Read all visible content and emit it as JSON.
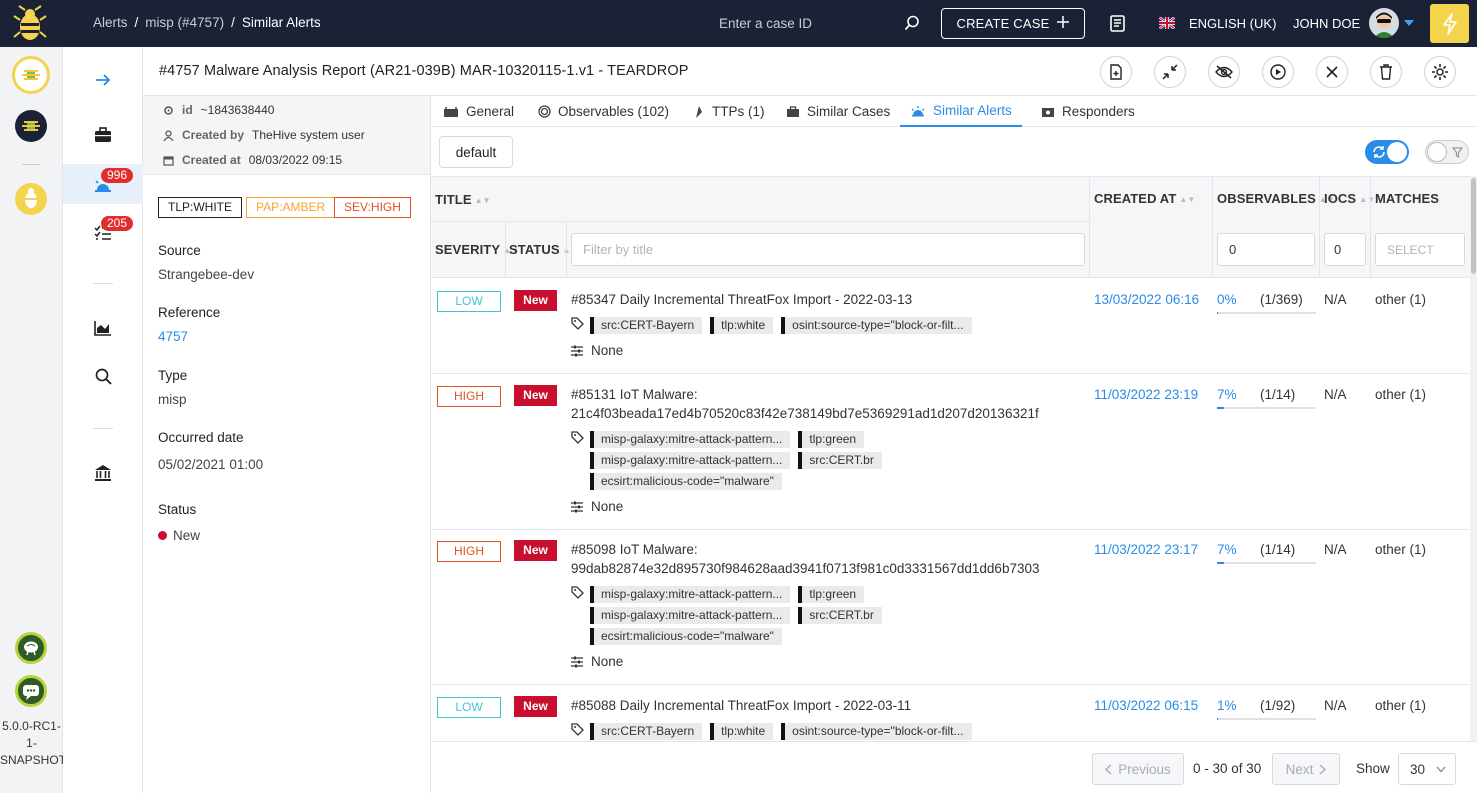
{
  "topbar": {
    "breadcrumb": [
      "Alerts",
      "misp (#4757)",
      "Similar Alerts"
    ],
    "case_search_placeholder": "Enter a case ID",
    "create_case_label": "CREATE CASE",
    "language": "ENGLISH (UK)",
    "user_name": "JOHN DOE"
  },
  "rail": {
    "version": "5.0.0-RC1-\n1-\nSNAPSHOT"
  },
  "nav": {
    "alerts_badge": "996",
    "tasks_badge": "205"
  },
  "header": {
    "title": "#4757 Malware Analysis Report (AR21-039B) MAR-10320115-1.v1 - TEARDROP"
  },
  "details": {
    "id_label": "id",
    "id_value": "~1843638440",
    "created_by_label": "Created by",
    "created_by_value": "TheHive system user",
    "created_at_label": "Created at",
    "created_at_value": "08/03/2022 09:15",
    "tlp": "TLP:WHITE",
    "pap": "PAP:AMBER",
    "sev": "SEV:HIGH",
    "source_label": "Source",
    "source_value": "Strangebee-dev",
    "reference_label": "Reference",
    "reference_value": "4757",
    "type_label": "Type",
    "type_value": "misp",
    "occurred_label": "Occurred date",
    "occurred_value": "05/02/2021 01:00",
    "status_label": "Status",
    "status_value": "New"
  },
  "tabs": [
    {
      "label": "General"
    },
    {
      "label": "Observables (102)"
    },
    {
      "label": "TTPs (1)"
    },
    {
      "label": "Similar Cases"
    },
    {
      "label": "Similar Alerts"
    },
    {
      "label": "Responders"
    }
  ],
  "toolbar": {
    "default_label": "default"
  },
  "table": {
    "headers": {
      "title": "TITLE",
      "created_at": "CREATED AT",
      "observables": "OBSERVABLES",
      "iocs": "IOCS",
      "matches": "MATCHES",
      "severity": "SEVERITY",
      "status": "STATUS"
    },
    "filters": {
      "title_placeholder": "Filter by title",
      "observables_value": "0",
      "iocs_value": "0",
      "matches_placeholder": "SELECT"
    },
    "rows": [
      {
        "severity": "LOW",
        "status": "New",
        "title": "#85347 Daily Incremental ThreatFox Import - 2022-03-13",
        "tags": [
          "src:CERT-Bayern",
          "tlp:white",
          "osint:source-type=\"block-or-filt..."
        ],
        "none_label": "None",
        "created_at": "13/03/2022 06:16",
        "obs_pct": "0%",
        "obs_frac": "(1/369)",
        "obs_fill": 0.27,
        "iocs": "N/A",
        "matches": "other (1)"
      },
      {
        "severity": "HIGH",
        "status": "New",
        "title": "#85131 IoT Malware:\n21c4f03beada17ed4b70520c83f42e738149bd7e5369291ad1d207d20136321f",
        "tags": [
          "misp-galaxy:mitre-attack-pattern...",
          "tlp:green",
          "misp-galaxy:mitre-attack-pattern...",
          "src:CERT.br",
          "ecsirt:malicious-code=\"malware\""
        ],
        "none_label": "None",
        "created_at": "11/03/2022 23:19",
        "obs_pct": "7%",
        "obs_frac": "(1/14)",
        "obs_fill": 7,
        "iocs": "N/A",
        "matches": "other (1)"
      },
      {
        "severity": "HIGH",
        "status": "New",
        "title": "#85098 IoT Malware:\n99dab82874e32d895730f984628aad3941f0713f981c0d3331567dd1dd6b7303",
        "tags": [
          "misp-galaxy:mitre-attack-pattern...",
          "tlp:green",
          "misp-galaxy:mitre-attack-pattern...",
          "src:CERT.br",
          "ecsirt:malicious-code=\"malware\""
        ],
        "none_label": "None",
        "created_at": "11/03/2022 23:17",
        "obs_pct": "7%",
        "obs_frac": "(1/14)",
        "obs_fill": 7,
        "iocs": "N/A",
        "matches": "other (1)"
      },
      {
        "severity": "LOW",
        "status": "New",
        "title": "#85088 Daily Incremental ThreatFox Import - 2022-03-11",
        "tags": [
          "src:CERT-Bayern",
          "tlp:white",
          "osint:source-type=\"block-or-filt..."
        ],
        "none_label": "",
        "created_at": "11/03/2022 06:15",
        "obs_pct": "1%",
        "obs_frac": "(1/92)",
        "obs_fill": 1,
        "iocs": "N/A",
        "matches": "other (1)"
      }
    ]
  },
  "pagination": {
    "previous_label": "Previous",
    "range": "0 - 30 of 30",
    "next_label": "Next",
    "show_label": "Show",
    "page_size": "30"
  },
  "colors": {
    "accent": "#2a8ce8",
    "topbar": "#1b2235",
    "low": "#43c4d4",
    "high": "#e0531f",
    "amber": "#f5a431",
    "status_new": "#c8102e",
    "brand_yellow": "#f4d44d"
  }
}
